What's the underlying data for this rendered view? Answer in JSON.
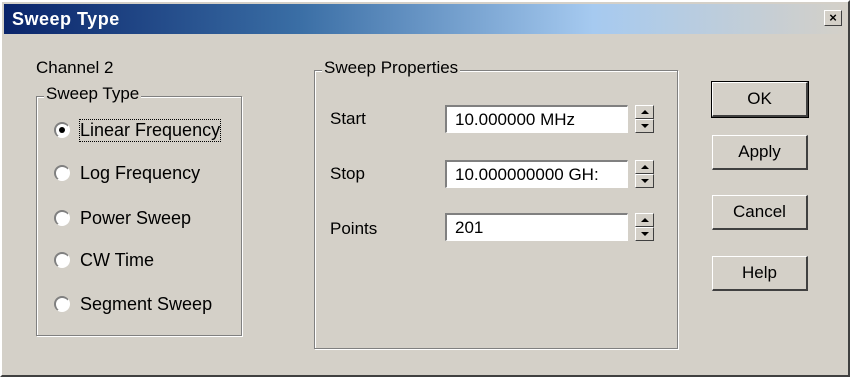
{
  "window": {
    "title": "Sweep Type",
    "close_glyph": "×"
  },
  "channel": "Channel 2",
  "sweep_type": {
    "legend": "Sweep Type",
    "options": [
      {
        "label": "Linear Frequency",
        "checked": true
      },
      {
        "label": "Log Frequency",
        "checked": false
      },
      {
        "label": "Power Sweep",
        "checked": false
      },
      {
        "label": "CW Time",
        "checked": false
      },
      {
        "label": "Segment Sweep",
        "checked": false
      }
    ]
  },
  "sweep_properties": {
    "legend": "Sweep Properties",
    "start": {
      "label": "Start",
      "value": "10.000000 MHz"
    },
    "stop": {
      "label": "Stop",
      "value": "10.000000000 GH:"
    },
    "points": {
      "label": "Points",
      "value": "201"
    }
  },
  "buttons": {
    "ok": "OK",
    "apply": "Apply",
    "cancel": "Cancel",
    "help": "Help"
  },
  "icons": {
    "close": "close-icon",
    "spin_up": "arrow-up-icon",
    "spin_down": "arrow-down-icon",
    "radio": "radio-icon"
  }
}
